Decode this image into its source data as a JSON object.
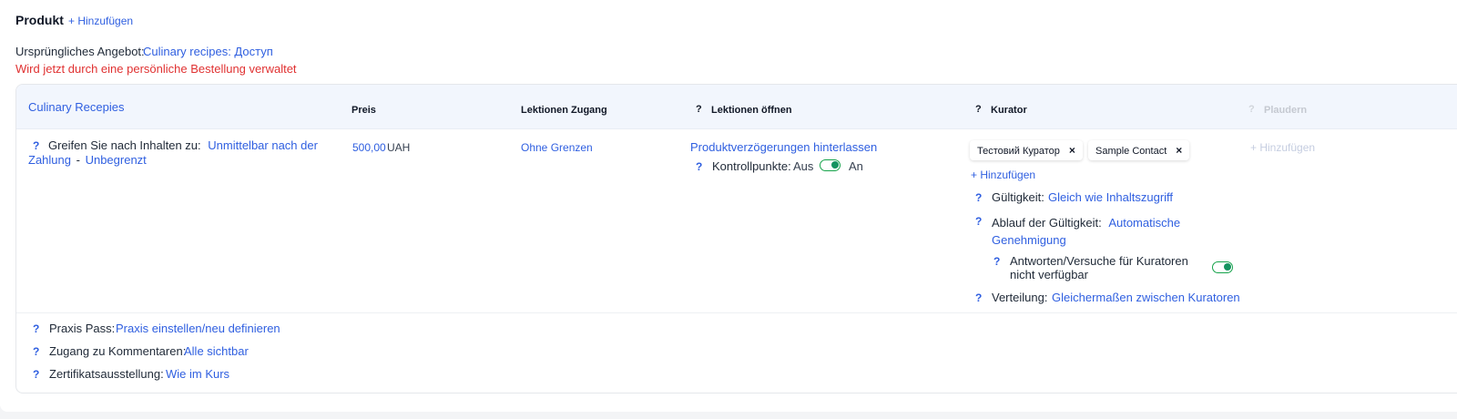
{
  "product": {
    "title": "Produkt",
    "add_label": "+ Hinzufügen"
  },
  "offer": {
    "label": "Ursprüngliches Angebot:",
    "link": "Culinary recipes: Доступ",
    "warning": "Wird jetzt durch eine persönliche Bestellung verwaltet"
  },
  "card": {
    "name": "Culinary Recepies",
    "columns": {
      "price": "Preis",
      "lessons_access": "Lektionen Zugang",
      "lessons_open": "Lektionen öffnen",
      "curator": "Kurator",
      "chat": "Plaudern"
    },
    "access": {
      "label": "Greifen Sie nach Inhalten zu:",
      "when": "Unmittelbar nach der Zahlung",
      "separator": "-",
      "duration": "Unbegrenzt"
    },
    "price": {
      "amount": "500,00",
      "currency": "UAH"
    },
    "lessons_access_value": "Ohne Grenzen",
    "lessons_open": {
      "delay_link": "Produktverzögerungen hinterlassen",
      "checkpoints_label": "Kontrollpunkte:",
      "off": "Aus",
      "on": "An"
    },
    "curators": {
      "chips": [
        "Тестовий Куратор",
        "Sample Contact"
      ],
      "remove_glyph": "×",
      "add_label": "+ Hinzufügen",
      "validity_label": "Gültigkeit:",
      "validity_value": "Gleich wie Inhaltszugriff",
      "expiry_label": "Ablauf der Gültigkeit:",
      "expiry_value": "Automatische Genehmigung",
      "answers_label": "Antworten/Versuche für Kuratoren nicht verfügbar",
      "distribution_label": "Verteilung:",
      "distribution_value": "Gleichermaßen zwischen Kuratoren"
    },
    "chat_add": "+ Hinzufügen",
    "footer": {
      "practice_label": "Praxis Pass:",
      "practice_value": "Praxis einstellen/neu definieren",
      "comments_label": "Zugang zu Kommentaren:",
      "comments_value": "Alle sichtbar",
      "certificate_label": "Zertifikatsausstellung:",
      "certificate_value": "Wie im Kurs"
    }
  },
  "help_glyph": "?",
  "colors": {
    "link": "#2f5fe0",
    "warning": "#e03131",
    "toggle_on": "#15935f",
    "header_bg": "#f2f6fd"
  }
}
